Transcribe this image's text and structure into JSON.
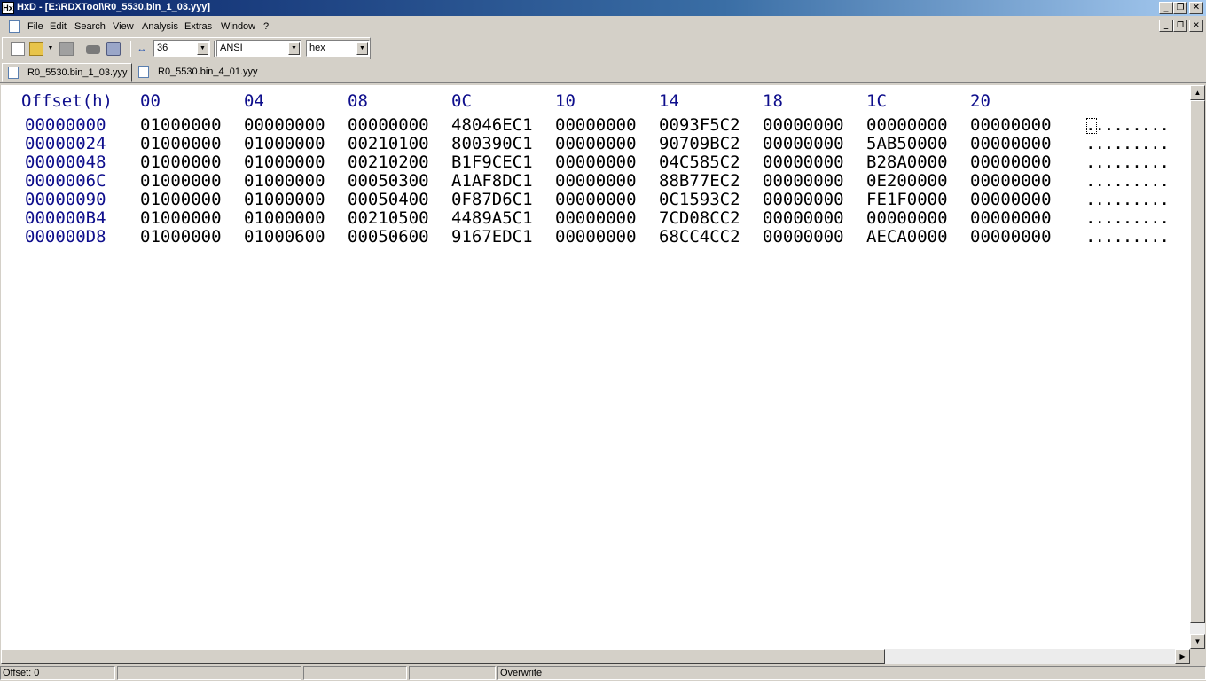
{
  "window": {
    "title": "HxD - [E:\\RDXTool\\R0_5530.bin_1_03.yyy]",
    "app_icon": "Hx"
  },
  "menu": [
    "File",
    "Edit",
    "Search",
    "View",
    "Analysis",
    "Extras",
    "Window",
    "?"
  ],
  "toolbar": {
    "bytes_per_row": "36",
    "charset": "ANSI",
    "offset_base": "hex"
  },
  "tabs": [
    "R0_5530.bin_1_03.yyy",
    "R0_5530.bin_4_01.yyy"
  ],
  "hex": {
    "offset_header": "Offset(h)",
    "columns": [
      "00",
      "04",
      "08",
      "0C",
      "10",
      "14",
      "18",
      "1C",
      "20"
    ],
    "rows": [
      {
        "offset": "00000000",
        "cells": [
          "01000000",
          "00000000",
          "00000000",
          "48046EC1",
          "00000000",
          "0093F5C2",
          "00000000",
          "00000000",
          "00000000"
        ],
        "text": "........."
      },
      {
        "offset": "00000024",
        "cells": [
          "01000000",
          "01000000",
          "00210100",
          "800390C1",
          "00000000",
          "90709BC2",
          "00000000",
          "5AB50000",
          "00000000"
        ],
        "text": "........."
      },
      {
        "offset": "00000048",
        "cells": [
          "01000000",
          "01000000",
          "00210200",
          "B1F9CEC1",
          "00000000",
          "04C585C2",
          "00000000",
          "B28A0000",
          "00000000"
        ],
        "text": "........."
      },
      {
        "offset": "0000006C",
        "cells": [
          "01000000",
          "01000000",
          "00050300",
          "A1AF8DC1",
          "00000000",
          "88B77EC2",
          "00000000",
          "0E200000",
          "00000000"
        ],
        "text": "........."
      },
      {
        "offset": "00000090",
        "cells": [
          "01000000",
          "01000000",
          "00050400",
          "0F87D6C1",
          "00000000",
          "0C1593C2",
          "00000000",
          "FE1F0000",
          "00000000"
        ],
        "text": "........."
      },
      {
        "offset": "000000B4",
        "cells": [
          "01000000",
          "01000000",
          "00210500",
          "4489A5C1",
          "00000000",
          "7CD08CC2",
          "00000000",
          "00000000",
          "00000000"
        ],
        "text": "........."
      },
      {
        "offset": "000000D8",
        "cells": [
          "01000000",
          "01000600",
          "00050600",
          "9167EDC1",
          "00000000",
          "68CC4CC2",
          "00000000",
          "AECA0000",
          "00000000"
        ],
        "text": "........."
      }
    ]
  },
  "status": {
    "offset": "Offset: 0",
    "mode": "Overwrite"
  },
  "colors": {
    "offset_blue": "#0e0e8c",
    "title_gradient_start": "#0a246a"
  }
}
